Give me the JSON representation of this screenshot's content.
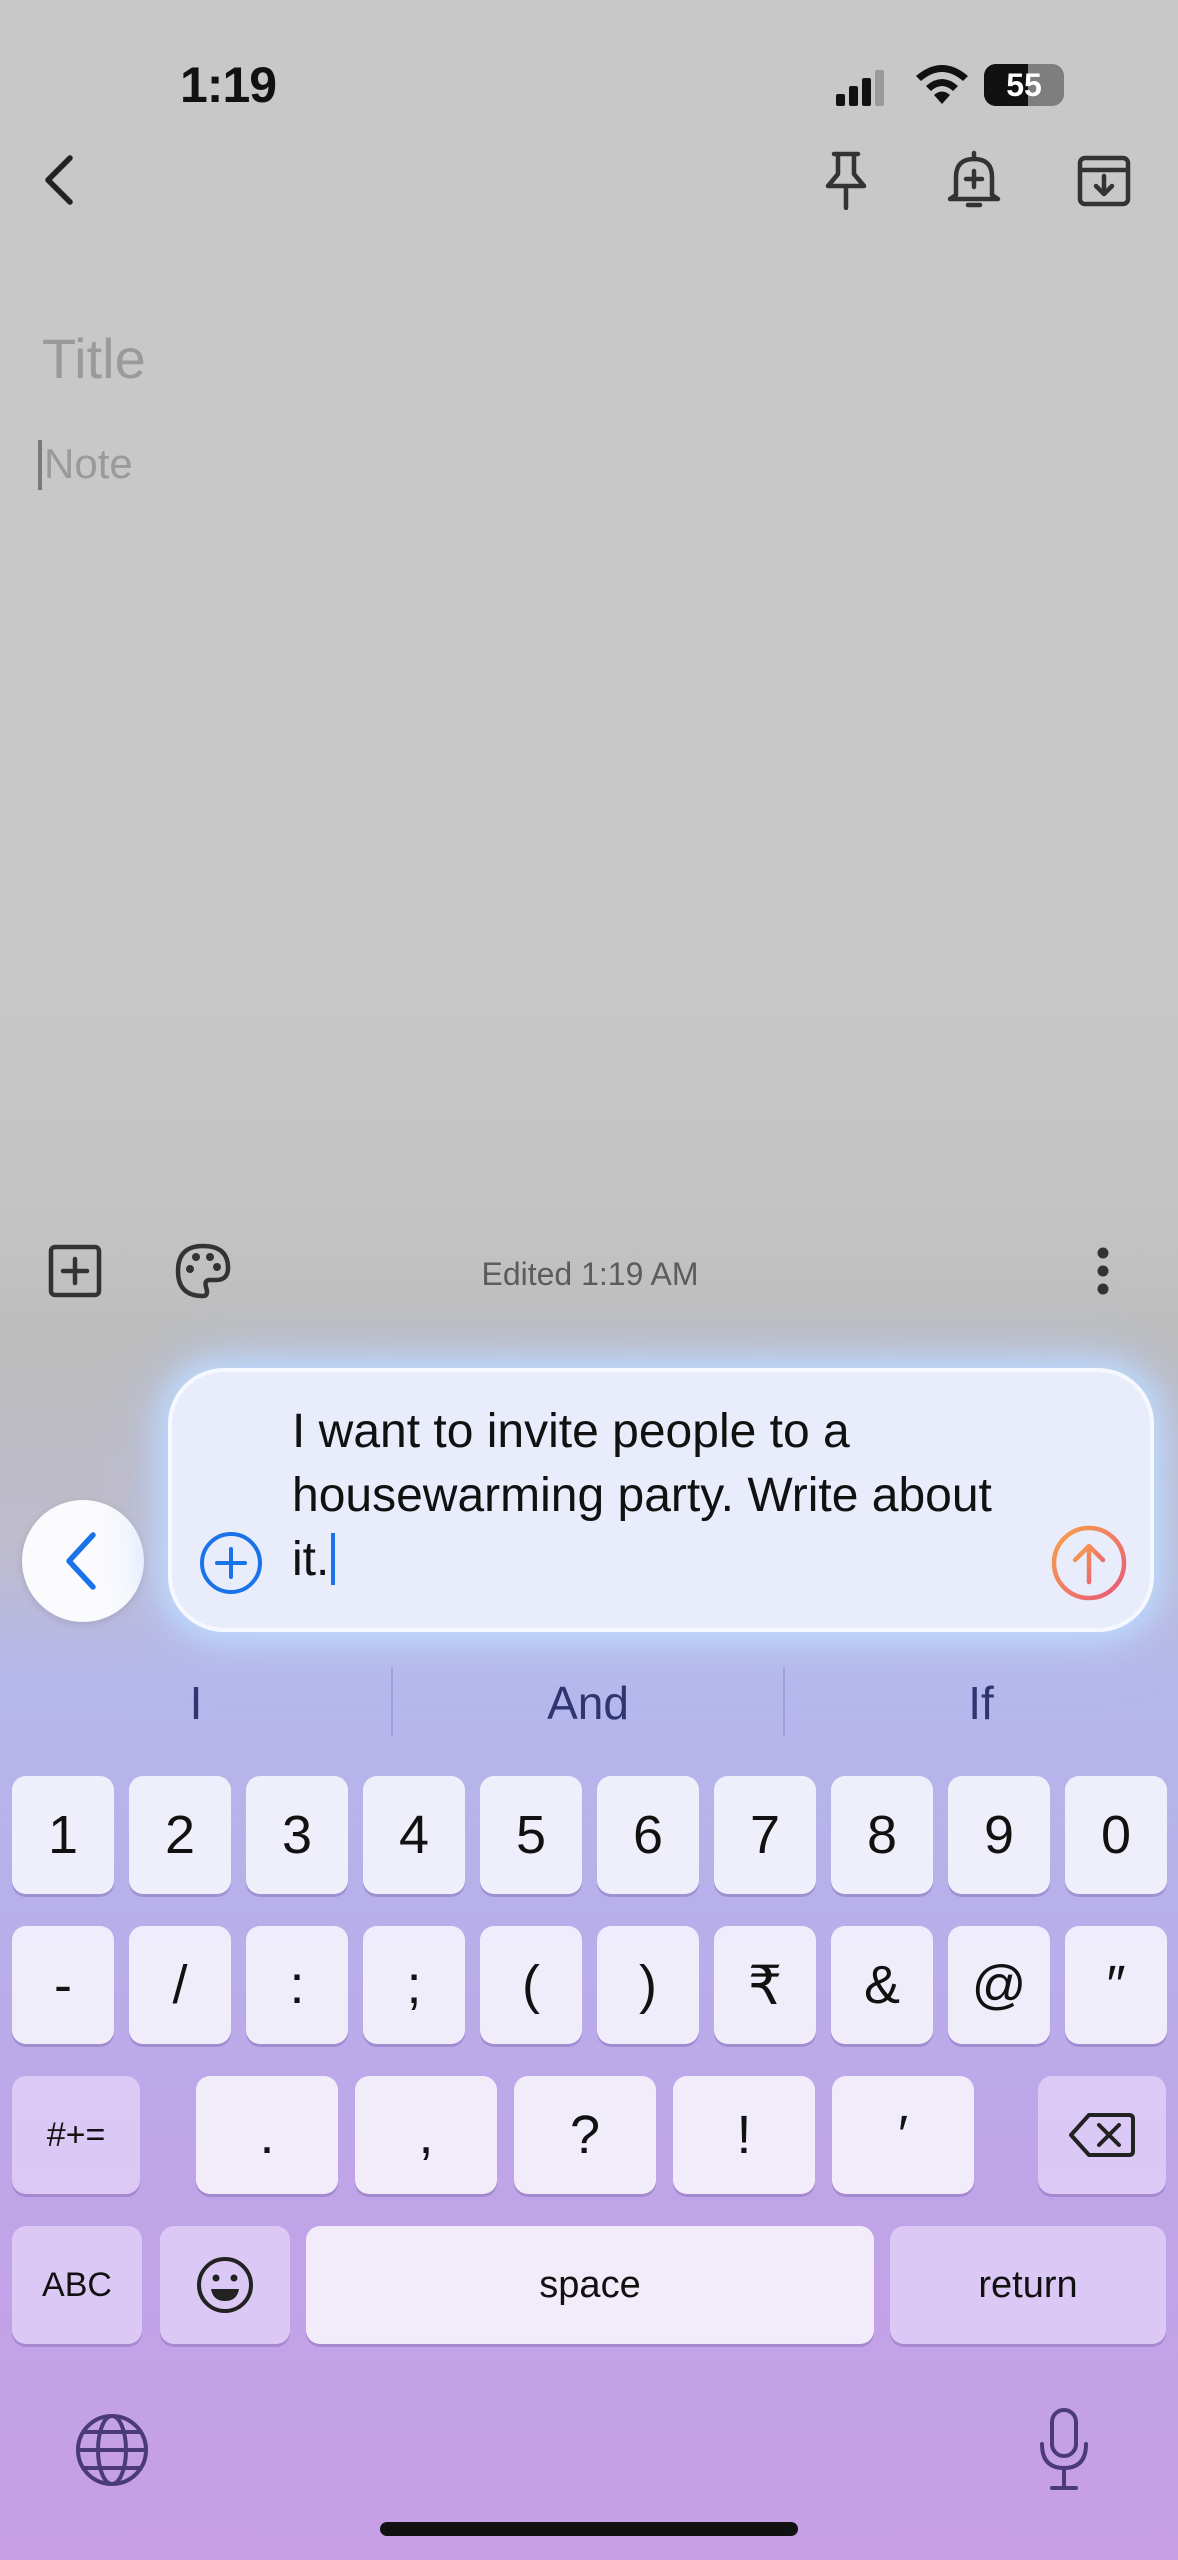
{
  "status": {
    "time": "1:19",
    "battery": "55",
    "battery_level": 0.55
  },
  "note": {
    "title_placeholder": "Title",
    "body_placeholder": "Note"
  },
  "toolbar": {
    "edited": "Edited 1:19 AM"
  },
  "prompt": {
    "text": "I want to invite people to a housewarming party. Write about it."
  },
  "suggestions": [
    "I",
    "And",
    "If"
  ],
  "keyboard": {
    "row1": [
      "1",
      "2",
      "3",
      "4",
      "5",
      "6",
      "7",
      "8",
      "9",
      "0"
    ],
    "row2": [
      "-",
      "/",
      ":",
      ";",
      "(",
      ")",
      "₹",
      "&",
      "@",
      "″"
    ],
    "row3": [
      "#+=",
      ".",
      ",",
      "?",
      "!",
      "′"
    ],
    "abc": "ABC",
    "space": "space",
    "return": "return"
  },
  "icons": [
    "back-icon",
    "pin-icon",
    "reminder-icon",
    "archive-icon",
    "add-box-icon",
    "palette-icon",
    "more-icon",
    "chevron-left-icon",
    "add-circle-icon",
    "send-icon",
    "backspace-icon",
    "emoji-icon",
    "globe-icon",
    "mic-icon"
  ],
  "colors": {
    "accent": "#1a73e8",
    "send": "#f08a4b"
  }
}
